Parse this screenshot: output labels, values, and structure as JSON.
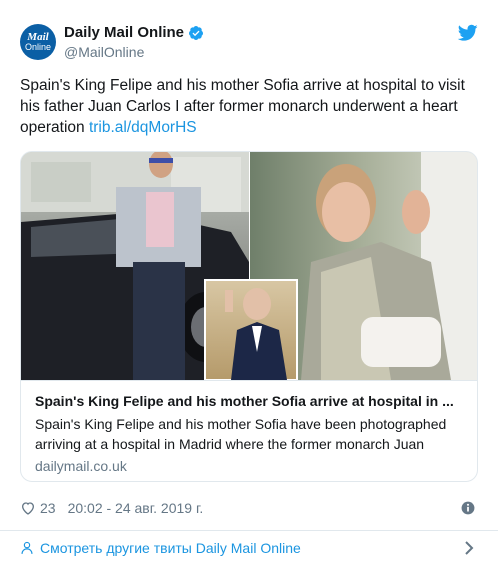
{
  "author": {
    "name": "Daily Mail Online",
    "handle": "@MailOnline",
    "avatar_line1": "Mail",
    "avatar_line2": "Online"
  },
  "tweet": {
    "text": "Spain's King Felipe and his mother Sofia arrive at hospital to visit his father Juan Carlos I after former monarch underwent a heart operation ",
    "link": "trib.al/dqMorHS"
  },
  "card": {
    "title": "Spain's King Felipe and his mother Sofia arrive at hospital in ...",
    "description": "Spain's King Felipe and his mother Sofia have been photographed arriving at a hospital in Madrid where the former monarch Juan",
    "domain": "dailymail.co.uk"
  },
  "footer": {
    "likes": "23",
    "timestamp": "20:02 - 24 авг. 2019 г."
  },
  "more": {
    "label": "Смотреть другие твиты Daily Mail Online"
  },
  "icons": {
    "brand": "twitter-bird-icon",
    "verified": "verified-badge-icon",
    "like": "heart-icon",
    "info": "info-icon",
    "more": "person-icon",
    "chevron": "chevron-right-icon"
  },
  "colors": {
    "link": "#1b95e0",
    "muted": "#657786",
    "border": "#e1e8ed",
    "avatar": "#0b5fa5"
  }
}
